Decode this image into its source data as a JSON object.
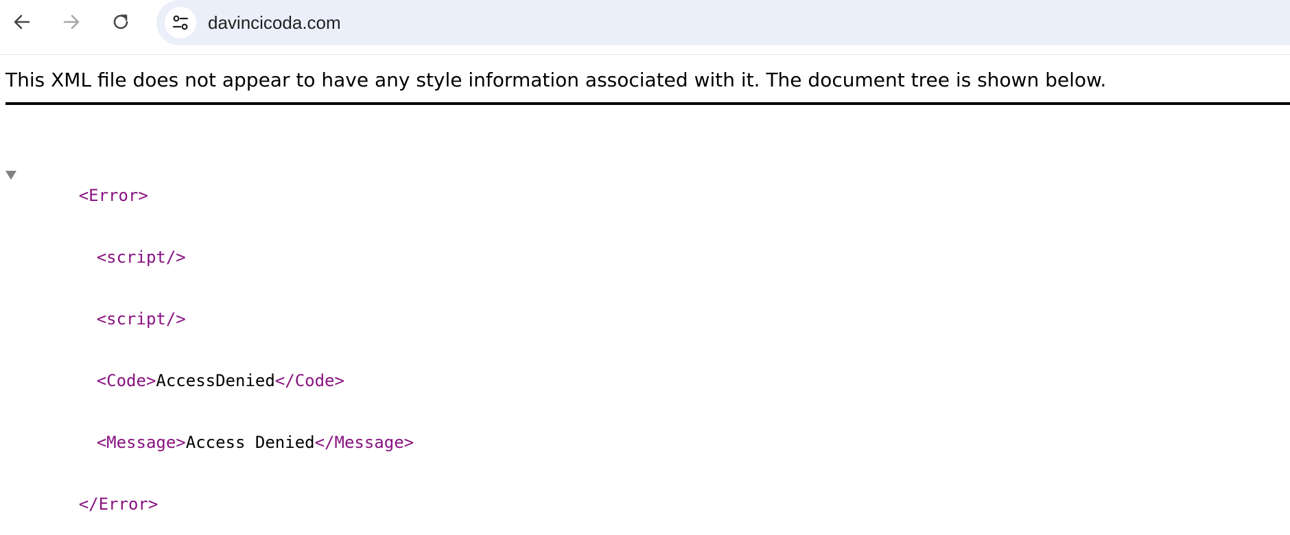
{
  "browser": {
    "url": "davincicoda.com",
    "back_icon": "arrow-left-icon",
    "forward_icon": "arrow-right-icon",
    "reload_icon": "reload-icon",
    "site_info_icon": "tune-icon"
  },
  "page": {
    "info_message": "This XML file does not appear to have any style information associated with it. The document tree is shown below.",
    "xml": {
      "root_open": "<Error>",
      "script1": "<script/>",
      "script2": "<script/>",
      "code_open": "<Code>",
      "code_value": "AccessDenied",
      "code_close": "</Code>",
      "message_open": "<Message>",
      "message_value": "Access Denied",
      "message_close": "</Message>",
      "root_close": "</Error>"
    }
  },
  "colors": {
    "tag": "#881280",
    "omnibox_bg": "#ebeff9",
    "disabled_icon": "#a6a6a6"
  }
}
